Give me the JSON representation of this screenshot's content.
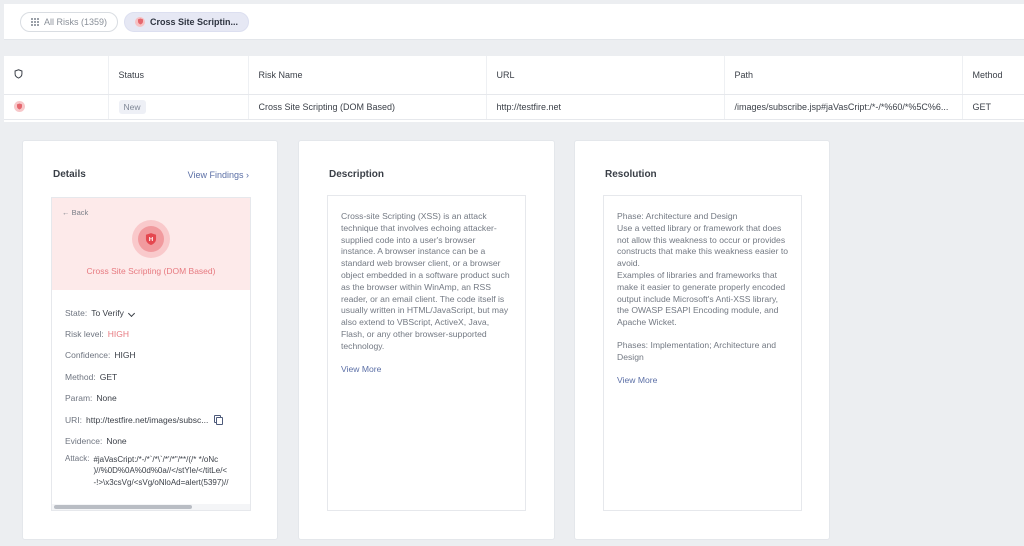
{
  "filters": {
    "all_label": "All Risks (1359)",
    "active_label": "Cross Site Scriptin..."
  },
  "table": {
    "headers": [
      "Status",
      "Risk Name",
      "URL",
      "Path",
      "Method"
    ],
    "row": {
      "status": "New",
      "risk_name": "Cross Site Scripting (DOM Based)",
      "url": "http://testfire.net",
      "path": "/images/subscribe.jsp#jaVasCript:/*-/*%60/*%5C%6...",
      "method": "GET"
    }
  },
  "details": {
    "title": "Details",
    "view_findings": "View Findings",
    "back": "Back",
    "risk_name": "Cross Site Scripting (DOM Based)",
    "fields": {
      "state_label": "State:",
      "state_value": "To Verify",
      "risk_label": "Risk level:",
      "risk_value": "HIGH",
      "confidence_label": "Confidence:",
      "confidence_value": "HIGH",
      "method_label": "Method:",
      "method_value": "GET",
      "param_label": "Param:",
      "param_value": "None",
      "uri_label": "URI:",
      "uri_value": "http://testfire.net/images/subsc...",
      "evidence_label": "Evidence:",
      "evidence_value": "None",
      "attack_label": "Attack:",
      "attack_value": "#jaVasCript:/*-/*`/*\\`/*'/*\"/**/(/* */oNc\n)//%0D%0A%0d%0a//</stYle/</titLe/<\n-!>\\x3csVg/<sVg/oNloAd=alert(5397)//"
    },
    "accent_color": "#e77a80"
  },
  "description": {
    "title": "Description",
    "text": "Cross-site Scripting (XSS) is an attack technique that involves echoing attacker-supplied code into a user's browser instance. A browser instance can be a standard web browser client, or a browser object embedded in a software product such as the browser within WinAmp, an RSS reader, or an email client. The code itself is usually written in HTML/JavaScript, but may also extend to VBScript, ActiveX, Java, Flash, or any other browser-supported technology.",
    "view_more": "View More"
  },
  "resolution": {
    "title": "Resolution",
    "p1": "Phase: Architecture and Design",
    "p2": "Use a vetted library or framework that does not allow this weakness to occur or provides constructs that make this weakness easier to avoid.",
    "p3": "Examples of libraries and frameworks that make it easier to generate properly encoded output include Microsoft's Anti-XSS library, the OWASP ESAPI Encoding module, and Apache Wicket.",
    "p4": "Phases: Implementation; Architecture and Design",
    "view_more": "View More"
  }
}
